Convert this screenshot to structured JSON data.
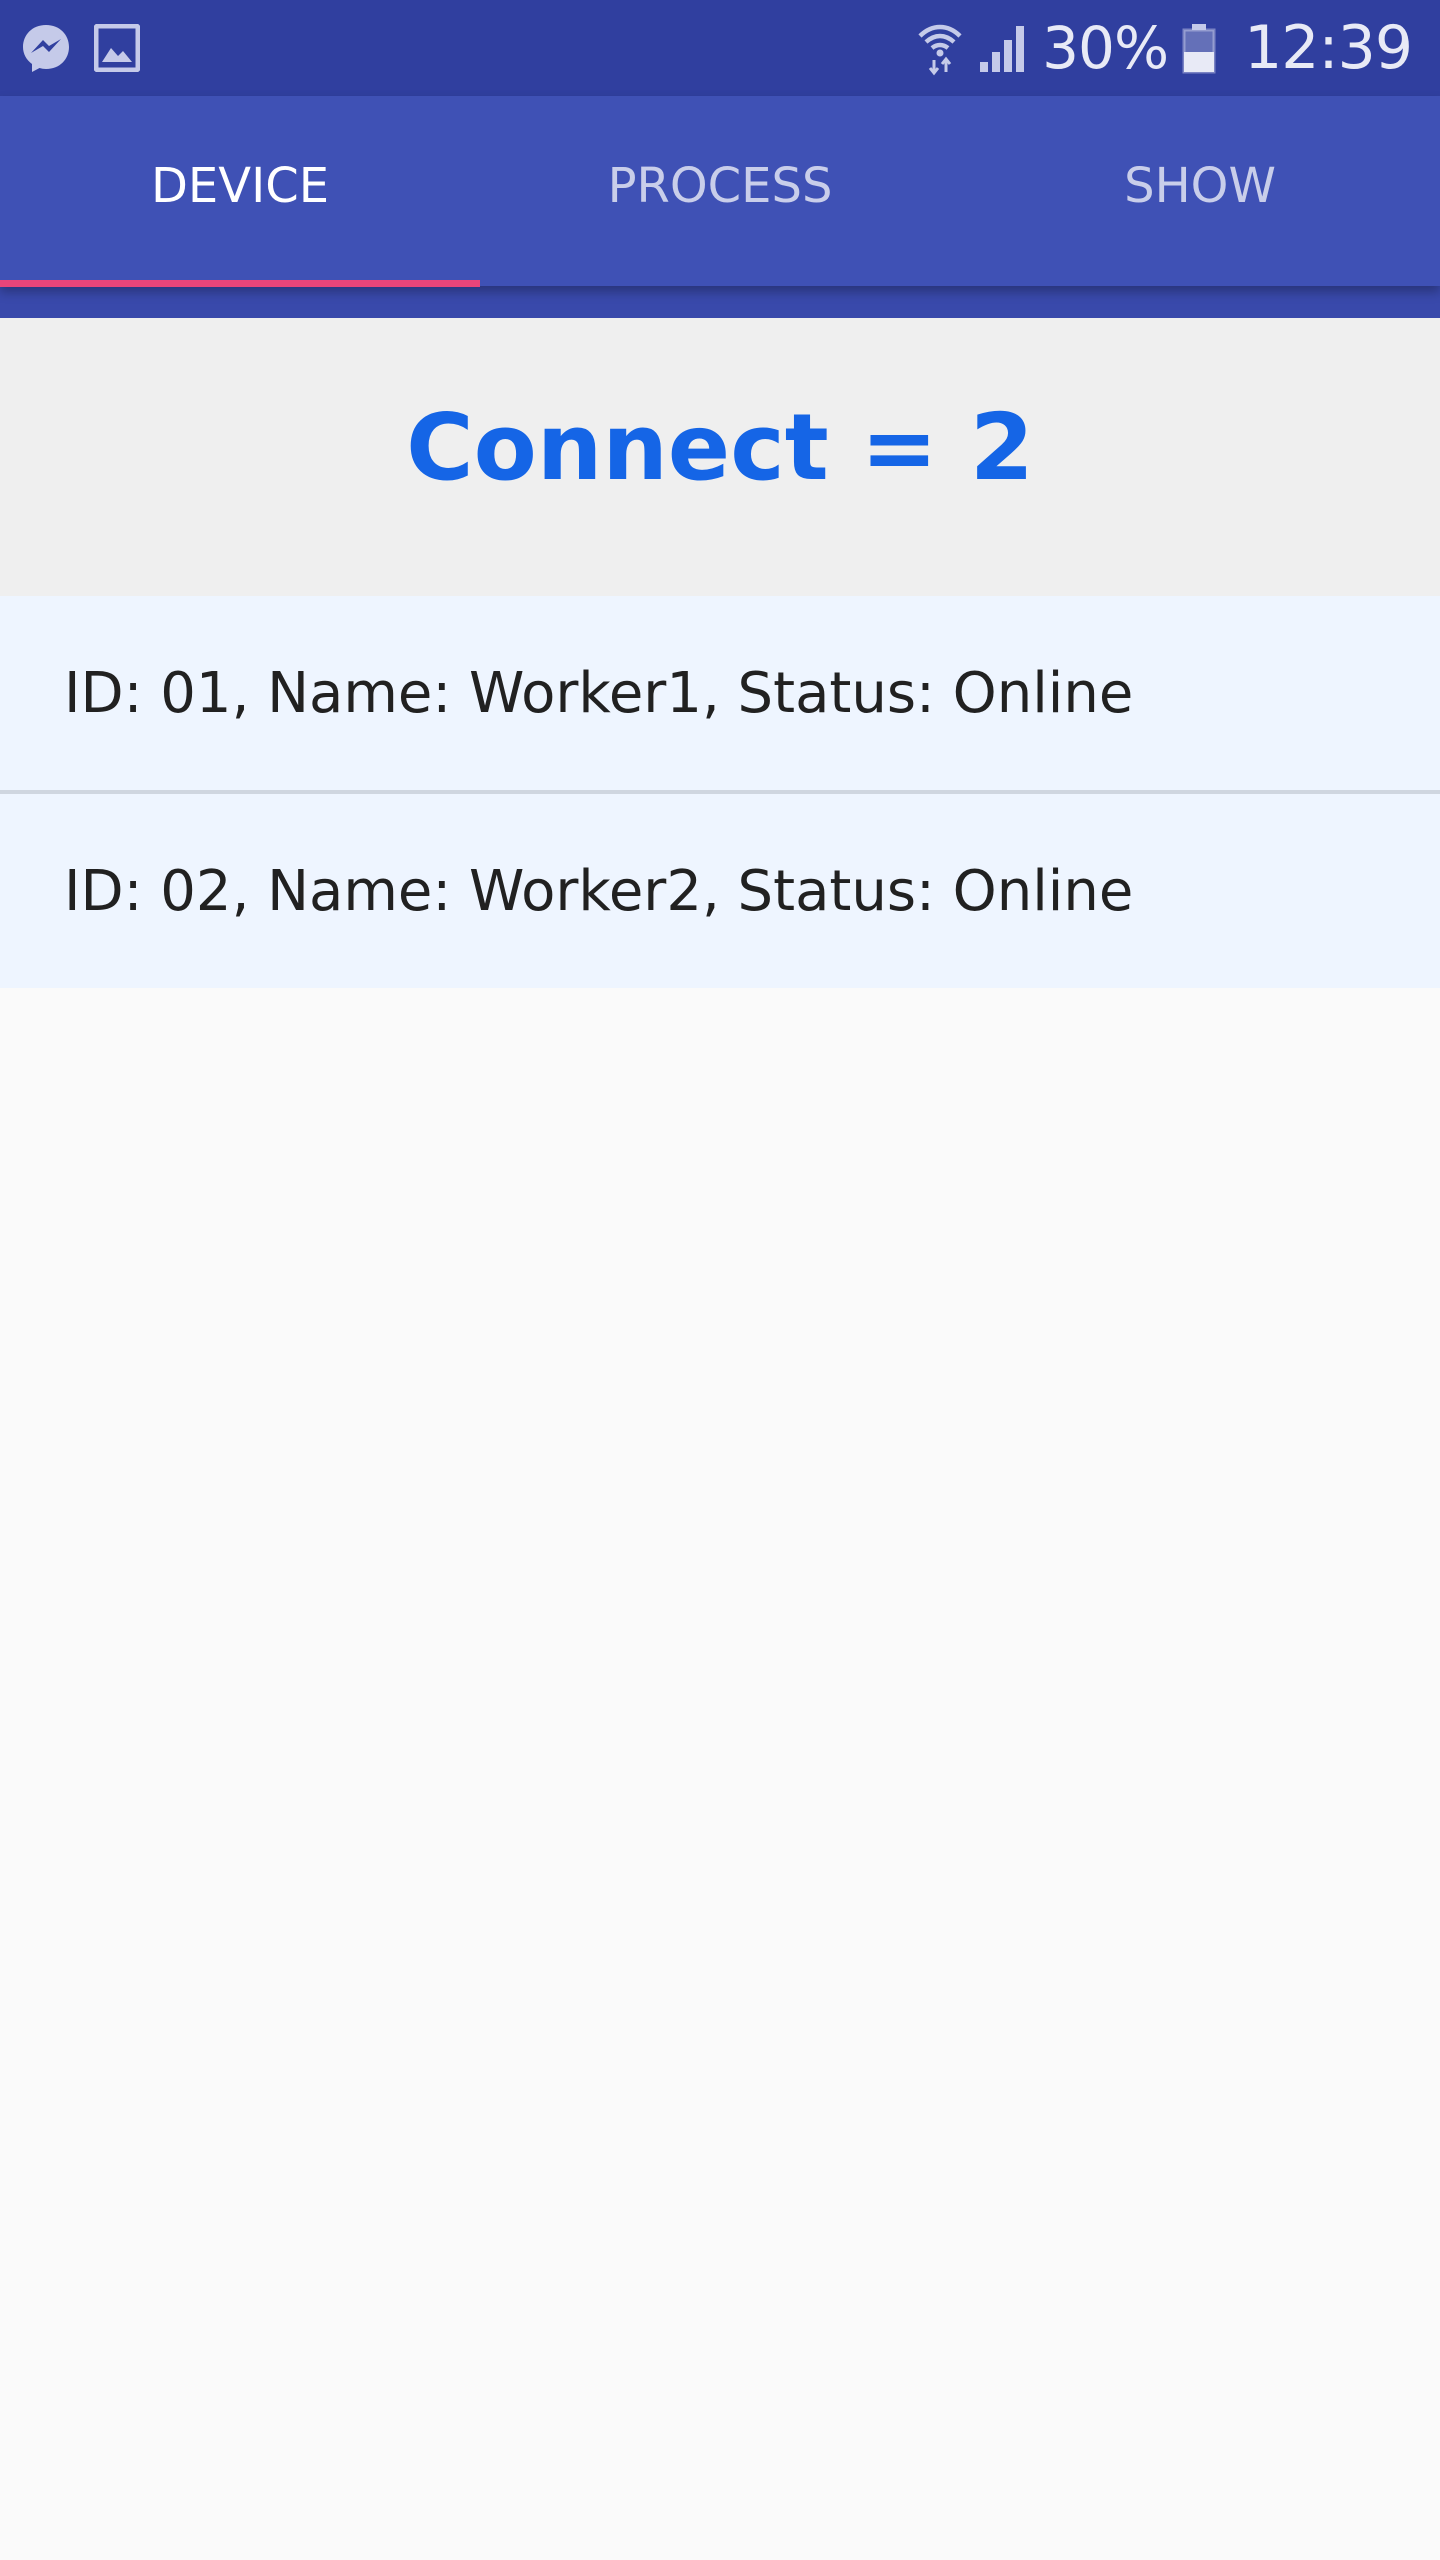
{
  "status_bar": {
    "left_icons": [
      "messenger-icon",
      "image-icon"
    ],
    "right_icons": [
      "wifi-icon",
      "signal-icon",
      "battery-icon"
    ],
    "battery_percent": "30%",
    "time": "12:39"
  },
  "tabs": [
    {
      "label": "DEVICE",
      "active": true
    },
    {
      "label": "PROCESS",
      "active": false
    },
    {
      "label": "SHOW",
      "active": false
    }
  ],
  "header": {
    "connect_text": "Connect = 2"
  },
  "devices": [
    {
      "text": "ID: 01, Name: Worker1, Status: Online"
    },
    {
      "text": "ID: 02, Name: Worker2, Status: Online"
    }
  ],
  "colors": {
    "status_bar": "#303f9f",
    "app_bar": "#3f51b5",
    "tab_indicator": "#e8457a",
    "connect_text": "#1565e6",
    "list_item_bg": "#eef5ff"
  }
}
